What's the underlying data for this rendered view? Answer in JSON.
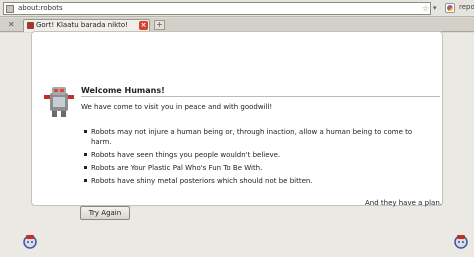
{
  "urlbar": {
    "url": "about:robots",
    "search_text": "repo"
  },
  "tabs": [
    {
      "label": "Gort! Klaatu barada nikto!"
    }
  ],
  "page": {
    "title": "Welcome Humans!",
    "intro": "We have come to visit you in peace and with goodwill!",
    "laws": [
      "Robots may not injure a human being or, through inaction, allow a human being to come to harm.",
      "Robots have seen things you people wouldn't believe.",
      "Robots are Your Plastic Pal Who's Fun To Be With.",
      "Robots have shiny metal posteriors which should not be bitten."
    ],
    "signoff": "And they have a plan.",
    "button_label": "Try Again"
  },
  "colors": {
    "tab_close": "#d9412c",
    "card_background": "#ffffff",
    "page_background": "#ebe9e4"
  },
  "icons": {
    "robot": "robot-icon",
    "corner_left": "dino-robot-icon",
    "corner_right": "dino-robot-icon"
  }
}
